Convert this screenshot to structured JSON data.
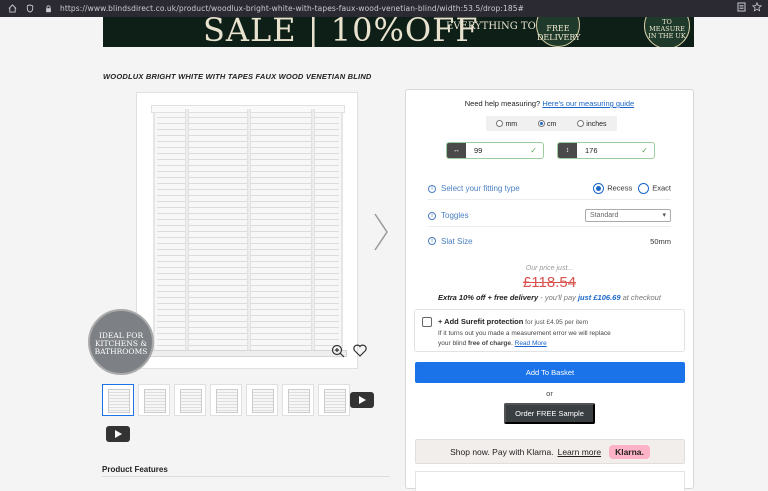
{
  "browser": {
    "url": "https://www.blindsdirect.co.uk/product/woodlux-bright-white-with-tapes-faux-wood-venetian-blind/width:53.5/drop:185#"
  },
  "banner": {
    "sale_text": "SALE | 10%OFF",
    "today_text": "EVERYTHING TODAY",
    "free_delivery": "FREE DELIVERY",
    "measure_text": "TO MEASURE IN THE UK"
  },
  "product": {
    "title": "WOODLUX BRIGHT WHITE WITH TAPES FAUX WOOD VENETIAN BLIND",
    "badge": "IDEAL FOR KITCHENS & BATHROOMS",
    "features_heading": "Product Features"
  },
  "panel": {
    "help_text": "Need help measuring?",
    "help_link": "Here's our measuring guide",
    "units": [
      {
        "label": "mm",
        "selected": false
      },
      {
        "label": "cm",
        "selected": true
      },
      {
        "label": "inches",
        "selected": false
      }
    ],
    "width_icon": "↔",
    "width_value": "99",
    "drop_icon": "↕",
    "drop_value": "176",
    "fitting_label": "Select your fitting type",
    "fitting_options": [
      {
        "label": "Recess",
        "selected": true
      },
      {
        "label": "Exact",
        "selected": false
      }
    ],
    "toggles_label": "Toggles",
    "toggles_value": "Standard",
    "slat_label": "Slat Size",
    "slat_value": "50mm",
    "our_price_label": "Our price just...",
    "old_price": "£118.54",
    "offer_bold": "Extra 10% off + free delivery",
    "offer_pay": " - you'll pay ",
    "offer_new_price": "just £106.69",
    "offer_end": " at checkout",
    "surefit_title": "+ Add Surefit protection",
    "surefit_price": " for just £4.95 per item",
    "surefit_desc_1": "If it turns out you made a measurement error we will replace",
    "surefit_desc_2": "your blind ",
    "surefit_desc_bold": "free of charge",
    "surefit_desc_3": ". ",
    "surefit_read_more": "Read More",
    "add_to_basket": "Add To Basket",
    "or_text": "or",
    "order_sample": "Order FREE Sample",
    "klarna_text": "Shop now. Pay with Klarna.",
    "klarna_learn": "Learn more",
    "klarna_brand": "Klarna."
  },
  "colors": {
    "accent": "#1a73e8",
    "price_old": "#d9534f",
    "klarna_pink": "#ffb3c7"
  }
}
